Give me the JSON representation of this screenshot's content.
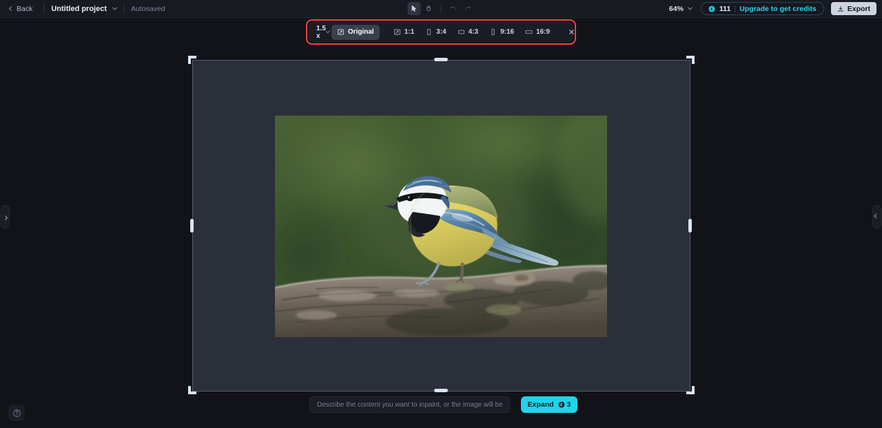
{
  "topbar": {
    "back_label": "Back",
    "project_name": "Untitled project",
    "autosaved_label": "Autosaved",
    "tools": [
      {
        "name": "select-tool",
        "icon": "cursor-icon",
        "active": true
      },
      {
        "name": "pan-tool",
        "icon": "hand-icon",
        "active": false
      }
    ],
    "history": [
      {
        "name": "undo-button",
        "icon": "undo-icon"
      },
      {
        "name": "redo-button",
        "icon": "redo-icon"
      }
    ],
    "zoom_level": "64%",
    "credits_count": "111",
    "upgrade_label": "Upgrade to get credits",
    "export_label": "Export"
  },
  "ratio_toolbar": {
    "scale_value": "1.5 x",
    "options": [
      {
        "label": "Original",
        "icon": "expand-frame-icon",
        "selected": true
      },
      {
        "label": "1:1",
        "icon": "expand-frame-icon",
        "selected": false
      },
      {
        "label": "3:4",
        "icon": "portrait-icon",
        "selected": false
      },
      {
        "label": "4:3",
        "icon": "landscape-icon",
        "selected": false
      },
      {
        "label": "9:16",
        "icon": "tall-portrait-icon",
        "selected": false
      },
      {
        "label": "16:9",
        "icon": "wide-landscape-icon",
        "selected": false
      }
    ],
    "close_label": "×"
  },
  "canvas": {
    "image_alt": "Eurasian blue tit perched on a mossy log against a blurred green background",
    "left_panel_toggle_icon": "chevron-right-icon",
    "right_panel_toggle_icon": "chevron-left-icon",
    "help_icon": "question-mark-icon"
  },
  "prompt": {
    "placeholder": "Describe the content you want to inpaint, or the image will be gene…",
    "value": "",
    "expand_label": "Expand",
    "expand_cost": "3"
  },
  "colors": {
    "app_bg": "#121319",
    "topbar_bg": "#181a22",
    "canvas_frame_bg": "#2b2f3a",
    "accent_cyan": "#1fd4ea",
    "highlight_red": "#f2453d",
    "handle": "#d8e4ef"
  }
}
